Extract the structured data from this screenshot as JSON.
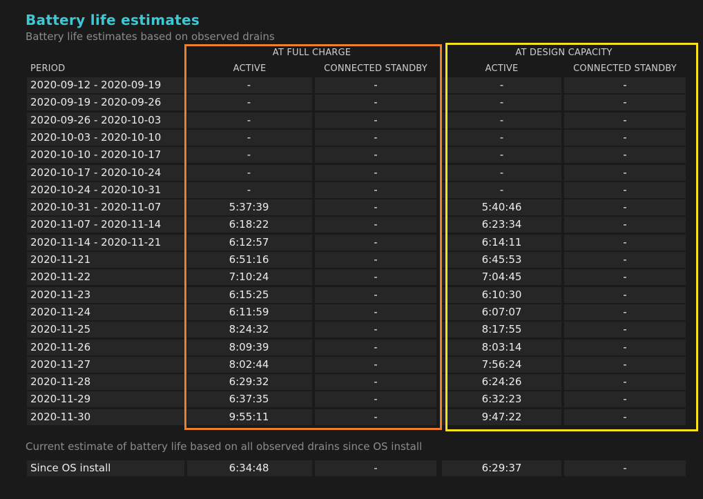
{
  "title": "Battery life estimates",
  "subtitle": "Battery life estimates based on observed drains",
  "groups": {
    "full_charge": "AT FULL CHARGE",
    "design_capacity": "AT DESIGN CAPACITY"
  },
  "columns": {
    "period": "PERIOD",
    "fc_active": "ACTIVE",
    "fc_standby": "CONNECTED STANDBY",
    "dc_active": "ACTIVE",
    "dc_standby": "CONNECTED STANDBY"
  },
  "rows": [
    {
      "period": "2020-09-12 - 2020-09-19",
      "fc_active": "-",
      "fc_standby": "-",
      "dc_active": "-",
      "dc_standby": "-"
    },
    {
      "period": "2020-09-19 - 2020-09-26",
      "fc_active": "-",
      "fc_standby": "-",
      "dc_active": "-",
      "dc_standby": "-"
    },
    {
      "period": "2020-09-26 - 2020-10-03",
      "fc_active": "-",
      "fc_standby": "-",
      "dc_active": "-",
      "dc_standby": "-"
    },
    {
      "period": "2020-10-03 - 2020-10-10",
      "fc_active": "-",
      "fc_standby": "-",
      "dc_active": "-",
      "dc_standby": "-"
    },
    {
      "period": "2020-10-10 - 2020-10-17",
      "fc_active": "-",
      "fc_standby": "-",
      "dc_active": "-",
      "dc_standby": "-"
    },
    {
      "period": "2020-10-17 - 2020-10-24",
      "fc_active": "-",
      "fc_standby": "-",
      "dc_active": "-",
      "dc_standby": "-"
    },
    {
      "period": "2020-10-24 - 2020-10-31",
      "fc_active": "-",
      "fc_standby": "-",
      "dc_active": "-",
      "dc_standby": "-"
    },
    {
      "period": "2020-10-31 - 2020-11-07",
      "fc_active": "5:37:39",
      "fc_standby": "-",
      "dc_active": "5:40:46",
      "dc_standby": "-"
    },
    {
      "period": "2020-11-07 - 2020-11-14",
      "fc_active": "6:18:22",
      "fc_standby": "-",
      "dc_active": "6:23:34",
      "dc_standby": "-"
    },
    {
      "period": "2020-11-14 - 2020-11-21",
      "fc_active": "6:12:57",
      "fc_standby": "-",
      "dc_active": "6:14:11",
      "dc_standby": "-"
    },
    {
      "period": "2020-11-21",
      "fc_active": "6:51:16",
      "fc_standby": "-",
      "dc_active": "6:45:53",
      "dc_standby": "-"
    },
    {
      "period": "2020-11-22",
      "fc_active": "7:10:24",
      "fc_standby": "-",
      "dc_active": "7:04:45",
      "dc_standby": "-"
    },
    {
      "period": "2020-11-23",
      "fc_active": "6:15:25",
      "fc_standby": "-",
      "dc_active": "6:10:30",
      "dc_standby": "-"
    },
    {
      "period": "2020-11-24",
      "fc_active": "6:11:59",
      "fc_standby": "-",
      "dc_active": "6:07:07",
      "dc_standby": "-"
    },
    {
      "period": "2020-11-25",
      "fc_active": "8:24:32",
      "fc_standby": "-",
      "dc_active": "8:17:55",
      "dc_standby": "-"
    },
    {
      "period": "2020-11-26",
      "fc_active": "8:09:39",
      "fc_standby": "-",
      "dc_active": "8:03:14",
      "dc_standby": "-"
    },
    {
      "period": "2020-11-27",
      "fc_active": "8:02:44",
      "fc_standby": "-",
      "dc_active": "7:56:24",
      "dc_standby": "-"
    },
    {
      "period": "2020-11-28",
      "fc_active": "6:29:32",
      "fc_standby": "-",
      "dc_active": "6:24:26",
      "dc_standby": "-"
    },
    {
      "period": "2020-11-29",
      "fc_active": "6:37:35",
      "fc_standby": "-",
      "dc_active": "6:32:23",
      "dc_standby": "-"
    },
    {
      "period": "2020-11-30",
      "fc_active": "9:55:11",
      "fc_standby": "-",
      "dc_active": "9:47:22",
      "dc_standby": "-"
    }
  ],
  "footer": {
    "caption": "Current estimate of battery life based on all observed drains since OS install",
    "row": {
      "period": "Since OS install",
      "fc_active": "6:34:48",
      "fc_standby": "-",
      "dc_active": "6:29:37",
      "dc_standby": "-"
    }
  },
  "colors": {
    "title": "#3cc9d6",
    "full_charge_highlight": "#f07f2b",
    "design_capacity_highlight": "#f8e11e",
    "background": "#1a1a1a",
    "cell_background": "#262626"
  }
}
